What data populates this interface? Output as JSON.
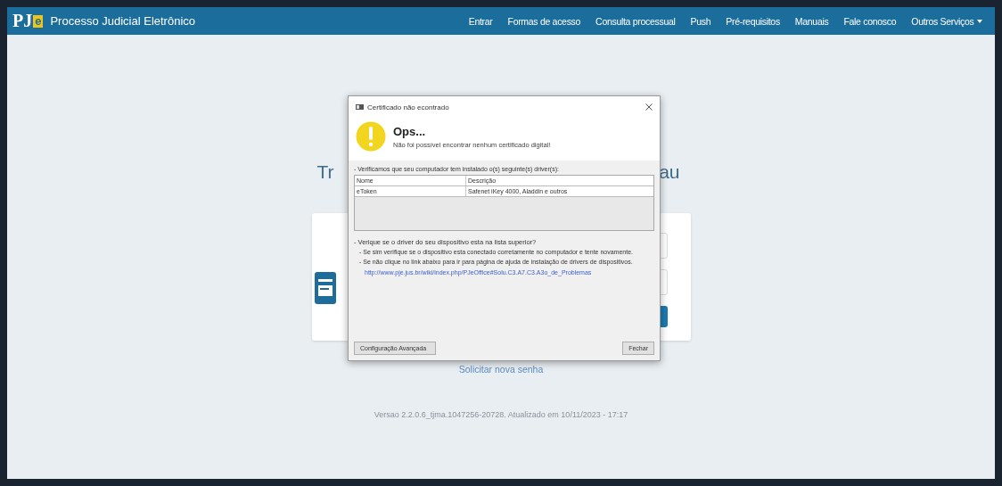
{
  "header": {
    "logo": {
      "main": "PJ",
      "accent": "e"
    },
    "title": "Processo Judicial Eletrônico",
    "nav": [
      {
        "label": "Entrar",
        "dropdown": false
      },
      {
        "label": "Formas de acesso",
        "dropdown": false
      },
      {
        "label": "Consulta processual",
        "dropdown": false
      },
      {
        "label": "Push",
        "dropdown": false
      },
      {
        "label": "Pré-requisitos",
        "dropdown": false
      },
      {
        "label": "Manuais",
        "dropdown": false
      },
      {
        "label": "Fale conosco",
        "dropdown": false
      },
      {
        "label": "Outros Serviços",
        "dropdown": true
      }
    ]
  },
  "login": {
    "heading_start": "Tr",
    "heading_end": "au",
    "forgot_link": "Solicitar nova senha"
  },
  "version": "Versao 2.2.0.6_tjma.1047256-20728. Atualizado em 10/11/2023 - 17:17",
  "dialog": {
    "title": "Certificado não econtrado",
    "heading": "Ops...",
    "message": "Não foi possível encontrar nenhum certificado digital!",
    "drivers_label": "- Verificamos que seu computador tem instalado o(s) seguinte(s) driver(s):",
    "table": {
      "columns": [
        "Nome",
        "Descrição"
      ],
      "rows": [
        [
          "eToken",
          "Safenet iKey 4000, Aladdin e outros"
        ]
      ]
    },
    "question": "- Verique se o driver do seu dispositivo esta na lista superior?",
    "hints": [
      "- Se sim verifique se o dispositivo esta conectado corretamente no computador e tente novamente.",
      "- Se não clique no link abaixo para ir para página de ajuda de instalação de drivers de dispositivos."
    ],
    "link": "http://www.pje.jus.br/wiki/index.php/PJeOffice#Solu.C3.A7.C3.A3o_de_Problemas",
    "buttons": [
      "Configuração Avançada",
      "Fechar"
    ]
  }
}
